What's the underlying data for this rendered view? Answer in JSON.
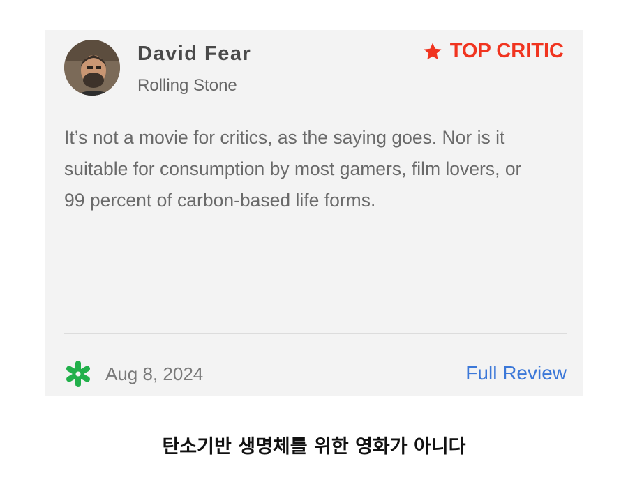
{
  "review": {
    "critic_name": "David Fear",
    "publication": "Rolling Stone",
    "badge_label": "TOP CRITIC",
    "quote": "It’s not a movie for critics, as the saying goes. Nor is it suitable for consumption by most gamers, film lovers, or 99 percent of carbon-based life forms.",
    "date": "Aug 8, 2024",
    "full_review_label": "Full Review",
    "score_icon": "fresh-splat-icon",
    "badge_icon": "star-icon"
  },
  "caption": "탄소기반 생명체를 위한 영화가 아니다",
  "colors": {
    "badge": "#f0341f",
    "fresh": "#22b04b",
    "link": "#3c78d8",
    "card_bg": "#f3f3f3"
  }
}
